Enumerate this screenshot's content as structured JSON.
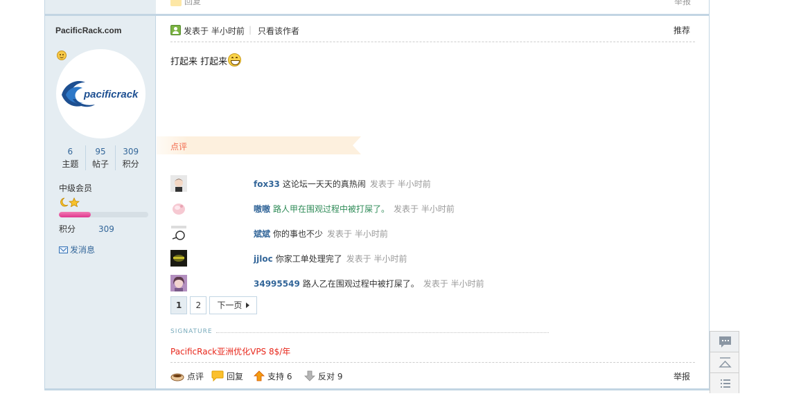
{
  "prev_post": {
    "reply_label": "回复",
    "report_label": "举报"
  },
  "author": {
    "name": "PacificRack.com",
    "avatar_logo_text": "pacificrack",
    "stats": [
      {
        "value": "6",
        "label": "主题"
      },
      {
        "value": "95",
        "label": "帖子"
      },
      {
        "value": "309",
        "label": "积分"
      }
    ],
    "usergroup": "中级会员",
    "level_progress": 0.36,
    "credits_label": "积分",
    "credits_value": "309",
    "send_message": "发消息"
  },
  "post": {
    "posted_time": "发表于 半小时前",
    "separator": "|",
    "only_author": "只看该作者",
    "recommend": "推荐",
    "body_text": "打起来 打起来"
  },
  "comments_section": {
    "title": "点评",
    "items": [
      {
        "user": "fox33",
        "message": "这论坛一天天的真热闹",
        "time": "发表于 半小时前",
        "green": false
      },
      {
        "user": "嗷嗷",
        "message": "路人甲在围观过程中被打屎了。",
        "time": "发表于 半小时前",
        "green": true
      },
      {
        "user": "斌斌",
        "message": "你的事也不少",
        "time": "发表于 半小时前",
        "green": false
      },
      {
        "user": "jjloc",
        "message": "你家工单处理完了",
        "time": "发表于 半小时前",
        "green": false
      },
      {
        "user": "34995549",
        "message": "路人乙在围观过程中被打屎了。",
        "time": "发表于 半小时前",
        "green": false
      }
    ],
    "pager": {
      "page1": "1",
      "page2": "2",
      "next": "下一页"
    }
  },
  "signature": {
    "label": "SIGNATURE",
    "text": "PacificRack亚洲优化VPS 8$/年"
  },
  "actions": {
    "comment": "点评",
    "reply": "回复",
    "support": "支持 6",
    "oppose": "反对 9",
    "report": "举报"
  },
  "colors": {
    "sidebar_bg": "#e5edf2",
    "border": "#c2d5e3",
    "link_blue": "#336699",
    "ribbon_bg": "#fdf0de",
    "ribbon_text": "#f26c4f",
    "signature_red": "#e8261a",
    "progress_pink": "#e0368e"
  }
}
